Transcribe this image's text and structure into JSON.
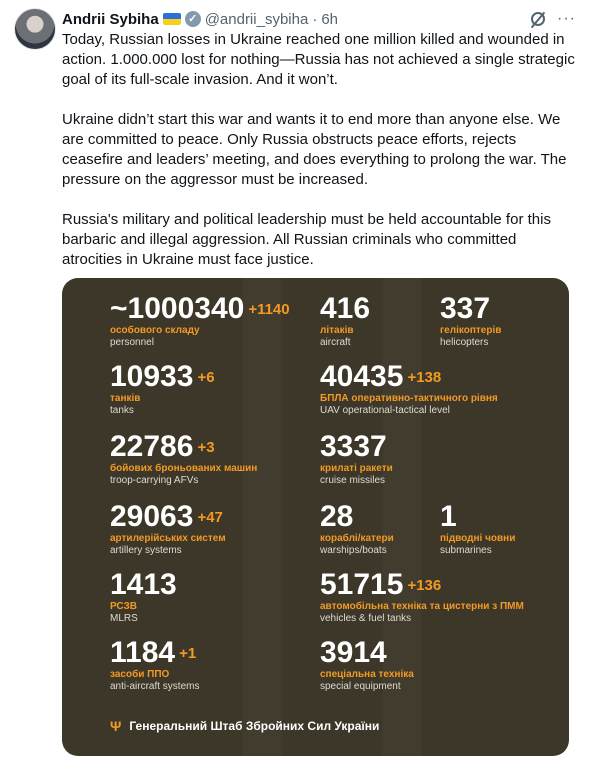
{
  "post": {
    "author": "Andrii Sybiha",
    "handle": "@andrii_sybiha",
    "separator": "·",
    "time": "6h",
    "paragraphs": [
      "Today, Russian losses in Ukraine reached one million killed and wounded in action. 1.000.000 lost for nothing—Russia has not achieved a single strategic goal of its full-scale invasion. And it won’t.",
      "Ukraine didn’t start this war and wants it to end more than anyone else. We are committed to peace. Only Russia obstructs peace efforts, rejects ceasefire and leaders’ meeting, and does everything to prolong the war. The pressure on the aggressor must be increased.",
      "Russia's military and political leadership must be held accountable for this barbaric and illegal aggression. All Russian criminals who committed atrocities in Ukraine must face justice."
    ]
  },
  "card": {
    "left": [
      {
        "value": "~1000340",
        "delta": "+1140",
        "ua": "особового складу",
        "en": "personnel"
      },
      {
        "value": "10933",
        "delta": "+6",
        "ua": "танків",
        "en": "tanks"
      },
      {
        "value": "22786",
        "delta": "+3",
        "ua": "бойових броньованих машин",
        "en": "troop-carrying AFVs"
      },
      {
        "value": "29063",
        "delta": "+47",
        "ua": "артилерійських систем",
        "en": "artillery systems"
      },
      {
        "value": "1413",
        "delta": "",
        "ua": "РСЗВ",
        "en": "MLRS"
      },
      {
        "value": "1184",
        "delta": "+1",
        "ua": "засоби ППО",
        "en": "anti-aircraft systems"
      }
    ],
    "right": [
      {
        "value": "416",
        "delta": "",
        "ua": "літаків",
        "en": "aircraft"
      },
      {
        "value": "337",
        "delta": "",
        "ua": "гелікоптерів",
        "en": "helicopters"
      },
      {
        "value": "40435",
        "delta": "+138",
        "ua": "БПЛА оперативно-тактичного рівня",
        "en": "UAV operational-tactical level"
      },
      {
        "value": "3337",
        "delta": "",
        "ua": "крилаті ракети",
        "en": "cruise missiles"
      },
      {
        "value": "28",
        "delta": "",
        "ua": "кораблі/катери",
        "en": "warships/boats"
      },
      {
        "value": "1",
        "delta": "",
        "ua": "підводні човни",
        "en": "submarines"
      },
      {
        "value": "51715",
        "delta": "+136",
        "ua": "автомобільна техніка та цистерни з ПММ",
        "en": "vehicles & fuel tanks"
      },
      {
        "value": "3914",
        "delta": "",
        "ua": "спеціальна техніка",
        "en": "special equipment"
      }
    ],
    "footer": "Генеральний Штаб Збройних Сил України"
  },
  "colors": {
    "accent": "#f39a24",
    "card_bg": "#3c3729"
  }
}
